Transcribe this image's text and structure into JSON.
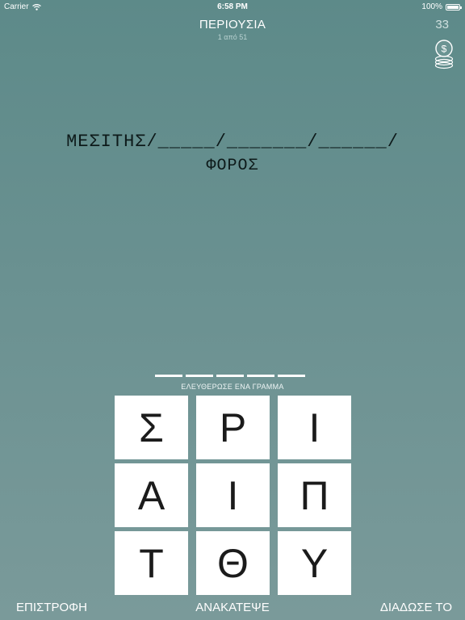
{
  "status": {
    "carrier": "Carrier",
    "time": "6:58 PM",
    "battery": "100%"
  },
  "header": {
    "title": "ΠΕΡΙΟΥΣΙΑ",
    "subtitle": "1 από 51",
    "coins": "33",
    "coin_icon": "dollar-coin-stack-icon"
  },
  "puzzle": {
    "line1": "ΜΕΣΙΤΗΣ/_____/_______/______/",
    "line2": "ΦΟΡΟΣ"
  },
  "answer": {
    "slots": 5,
    "hint": "ΕΛΕΥΘΕΡΩΣΕ ΕΝΑ ΓΡΑΜΜΑ"
  },
  "tiles": [
    "Σ",
    "Ρ",
    "Ι",
    "Α",
    "Ι",
    "Π",
    "Τ",
    "Θ",
    "Υ"
  ],
  "bottom": {
    "back": "ΕΠΙΣΤΡΟΦΗ",
    "shuffle": "ΑΝΑΚΑΤΕΨΕ",
    "share": "ΔΙΑΔΩΣΕ ΤΟ"
  }
}
